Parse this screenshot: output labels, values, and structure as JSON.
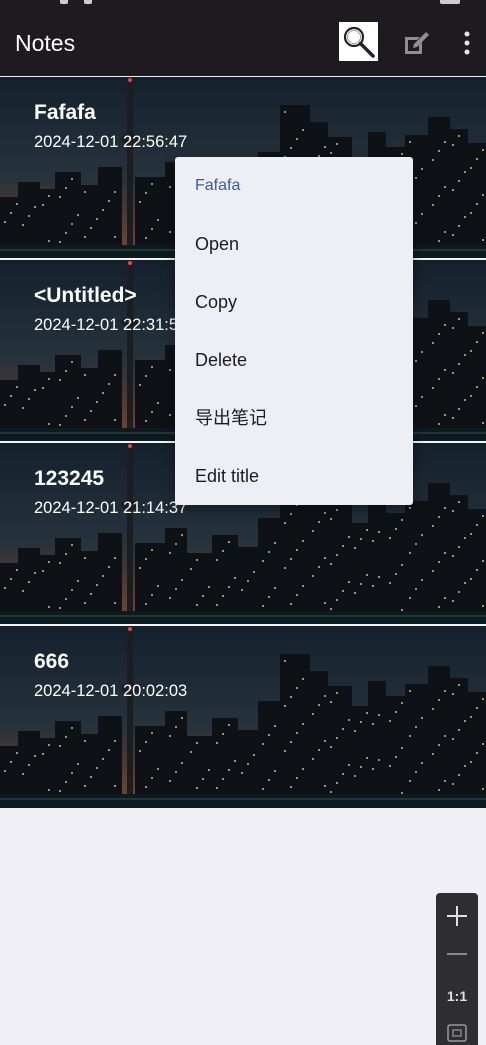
{
  "app_bar": {
    "title": "Notes",
    "actions": [
      {
        "icon": "search-icon"
      },
      {
        "icon": "edit-note-icon"
      },
      {
        "icon": "more-vertical-icon"
      }
    ]
  },
  "notes": [
    {
      "title": "Fafafa",
      "date": "2024-12-01 22:56:47"
    },
    {
      "title": "<Untitled>",
      "date": "2024-12-01 22:31:5"
    },
    {
      "title": "123245",
      "date": "2024-12-01 21:14:37"
    },
    {
      "title": "666",
      "date": "2024-12-01 20:02:03"
    }
  ],
  "context_menu": {
    "header": "Fafafa",
    "items": [
      {
        "label": "Open"
      },
      {
        "label": "Copy"
      },
      {
        "label": "Delete"
      },
      {
        "label": "导出笔记"
      },
      {
        "label": "Edit title"
      }
    ]
  },
  "zoom_controls": {
    "zoom_in_icon": "plus-icon",
    "zoom_out_icon": "minus-icon",
    "reset_label": "1:1",
    "fit_icon": "fit-screen-icon"
  },
  "colors": {
    "app_bar_bg": "#1d1b20",
    "menu_bg": "#eeeef5",
    "menu_header": "#3c5a9a",
    "page_bg": "#f0eff5"
  }
}
